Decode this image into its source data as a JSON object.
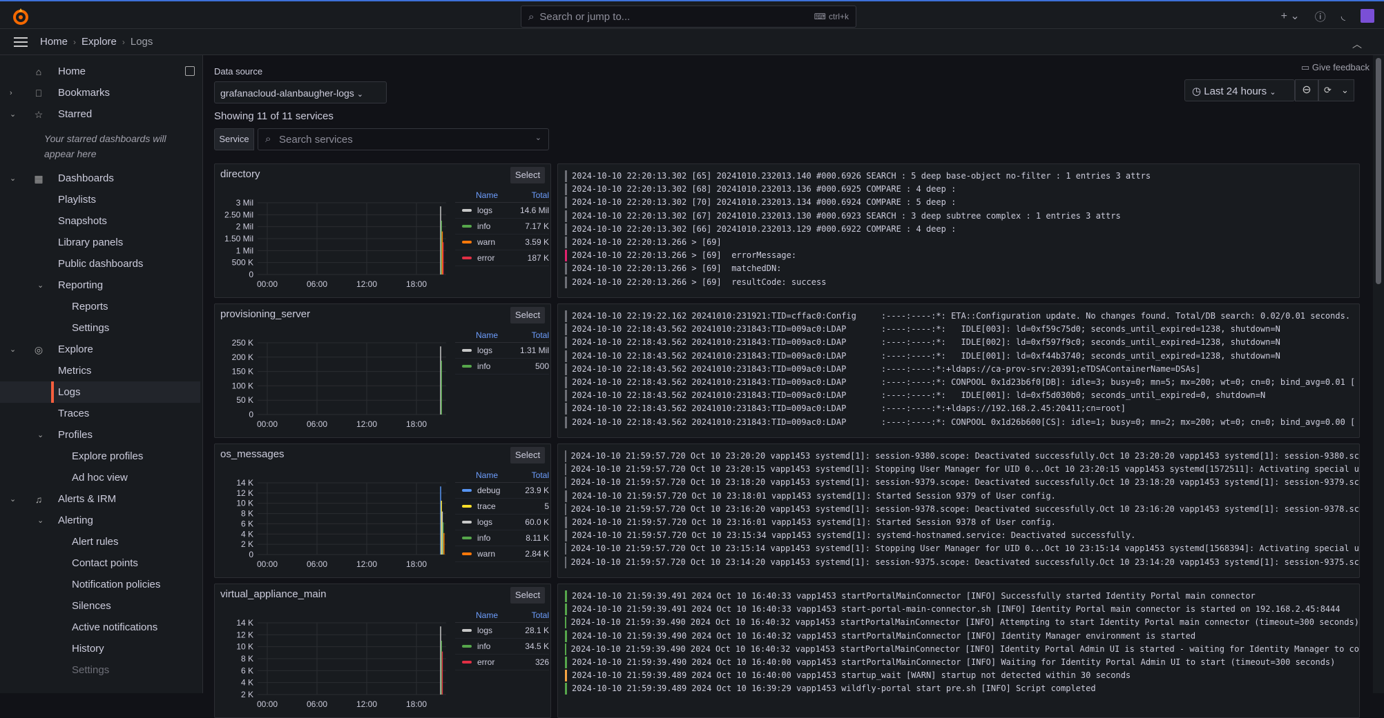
{
  "topbar": {
    "search_placeholder": "Search or jump to...",
    "search_shortcut": "ctrl+k",
    "new_label": "+"
  },
  "breadcrumb": [
    "Home",
    "Explore",
    "Logs"
  ],
  "sidebar": {
    "items": [
      {
        "label": "Home",
        "icon": "home-icon",
        "caret": ""
      },
      {
        "label": "Bookmarks",
        "icon": "bookmark-icon",
        "caret": "›"
      },
      {
        "label": "Starred",
        "icon": "star-icon",
        "caret": "⌄"
      },
      {
        "label": "Dashboards",
        "icon": "dashboards-icon",
        "caret": "⌄"
      },
      {
        "label": "Playlists"
      },
      {
        "label": "Snapshots"
      },
      {
        "label": "Library panels"
      },
      {
        "label": "Public dashboards"
      },
      {
        "label": "Reporting",
        "caret": "⌄"
      },
      {
        "label": "Reports"
      },
      {
        "label": "Settings"
      },
      {
        "label": "Explore",
        "icon": "compass-icon",
        "caret": "⌄"
      },
      {
        "label": "Metrics"
      },
      {
        "label": "Logs"
      },
      {
        "label": "Traces"
      },
      {
        "label": "Profiles",
        "caret": "⌄"
      },
      {
        "label": "Explore profiles"
      },
      {
        "label": "Ad hoc view"
      },
      {
        "label": "Alerts & IRM",
        "icon": "bell-icon",
        "caret": "⌄"
      },
      {
        "label": "Alerting",
        "caret": "⌄"
      },
      {
        "label": "Alert rules"
      },
      {
        "label": "Contact points"
      },
      {
        "label": "Notification policies"
      },
      {
        "label": "Silences"
      },
      {
        "label": "Active notifications"
      },
      {
        "label": "History"
      },
      {
        "label": "Settings"
      }
    ],
    "starred_note": "Your starred dashboards will appear here"
  },
  "toolbar": {
    "data_source_label": "Data source",
    "data_source": "grafanacloud-alanbaugher-logs",
    "showing": "Showing 11 of 11 services",
    "service_tag": "Service",
    "search_services": "Search services",
    "feedback": "Give feedback",
    "time_range": "Last 24 hours"
  },
  "panels": [
    {
      "title": "directory",
      "select": "Select",
      "y_ticks": [
        "3 Mil",
        "2.50 Mil",
        "2 Mil",
        "1.50 Mil",
        "1 Mil",
        "500 K",
        "0"
      ],
      "legend": [
        {
          "name": "logs",
          "total": "14.6 Mil",
          "color": "#c7c7c7"
        },
        {
          "name": "info",
          "total": "7.17 K",
          "color": "#56a64b"
        },
        {
          "name": "warn",
          "total": "3.59 K",
          "color": "#ff780a"
        },
        {
          "name": "error",
          "total": "187 K",
          "color": "#e02f44"
        }
      ],
      "logs": [
        {
          "l": "info_g",
          "t": "2024-10-10 22:20:13.302 [65] 20241010.232013.140 #000.6926 SEARCH : 5 deep base-object no-filter : 1 entries 3 attrs"
        },
        {
          "l": "n",
          "t": "2024-10-10 22:20:13.302 [68] 20241010.232013.136 #000.6925 COMPARE : 4 deep :"
        },
        {
          "l": "n",
          "t": "2024-10-10 22:20:13.302 [70] 20241010.232013.134 #000.6924 COMPARE : 5 deep :"
        },
        {
          "l": "n",
          "t": "2024-10-10 22:20:13.302 [67] 20241010.232013.130 #000.6923 SEARCH : 3 deep subtree complex : 1 entries 3 attrs"
        },
        {
          "l": "n",
          "t": "2024-10-10 22:20:13.302 [66] 20241010.232013.129 #000.6922 COMPARE : 4 deep :"
        },
        {
          "l": "n",
          "t": "2024-10-10 22:20:13.266 > [69]"
        },
        {
          "l": "err",
          "t": "2024-10-10 22:20:13.266 > [69]  errorMessage:"
        },
        {
          "l": "n",
          "t": "2024-10-10 22:20:13.266 > [69]  matchedDN:"
        },
        {
          "l": "n",
          "t": "2024-10-10 22:20:13.266 > [69]  resultCode: success"
        }
      ]
    },
    {
      "title": "provisioning_server",
      "select": "Select",
      "y_ticks": [
        "250 K",
        "200 K",
        "150 K",
        "100 K",
        "50 K",
        "0"
      ],
      "legend": [
        {
          "name": "logs",
          "total": "1.31 Mil",
          "color": "#c7c7c7"
        },
        {
          "name": "info",
          "total": "500",
          "color": "#56a64b"
        }
      ],
      "logs": [
        {
          "l": "n",
          "t": "2024-10-10 22:19:22.162 20241010:231921:TID=cffac0:Config     :----:----:*: ETA::Configuration update. No changes found. Total/DB search: 0.02/0.01 seconds."
        },
        {
          "l": "n",
          "t": "2024-10-10 22:18:43.562 20241010:231843:TID=009ac0:LDAP       :----:----:*:   IDLE[003]: ld=0xf59c75d0; seconds_until_expired=1238, shutdown=N"
        },
        {
          "l": "n",
          "t": "2024-10-10 22:18:43.562 20241010:231843:TID=009ac0:LDAP       :----:----:*:   IDLE[002]: ld=0xf597f9c0; seconds_until_expired=1238, shutdown=N"
        },
        {
          "l": "n",
          "t": "2024-10-10 22:18:43.562 20241010:231843:TID=009ac0:LDAP       :----:----:*:   IDLE[001]: ld=0xf44b3740; seconds_until_expired=1238, shutdown=N"
        },
        {
          "l": "n",
          "t": "2024-10-10 22:18:43.562 20241010:231843:TID=009ac0:LDAP       :----:----:*:+ldaps://ca-prov-srv:20391;eTDSAContainerName=DSAs]"
        },
        {
          "l": "n",
          "t": "2024-10-10 22:18:43.562 20241010:231843:TID=009ac0:LDAP       :----:----:*: CONPOOL 0x1d23b6f0[DB]: idle=3; busy=0; mn=5; mx=200; wt=0; cn=0; bind_avg=0.01 ["
        },
        {
          "l": "n",
          "t": "2024-10-10 22:18:43.562 20241010:231843:TID=009ac0:LDAP       :----:----:*:   IDLE[001]: ld=0xf5d030b0; seconds_until_expired=0, shutdown=N"
        },
        {
          "l": "n",
          "t": "2024-10-10 22:18:43.562 20241010:231843:TID=009ac0:LDAP       :----:----:*:+ldaps://192.168.2.45:20411;cn=root]"
        },
        {
          "l": "n",
          "t": "2024-10-10 22:18:43.562 20241010:231843:TID=009ac0:LDAP       :----:----:*: CONPOOL 0x1d26b600[CS]: idle=1; busy=0; mn=2; mx=200; wt=0; cn=0; bind_avg=0.00 ["
        }
      ]
    },
    {
      "title": "os_messages",
      "select": "Select",
      "y_ticks": [
        "14 K",
        "12 K",
        "10 K",
        "8 K",
        "6 K",
        "4 K",
        "2 K",
        "0"
      ],
      "legend": [
        {
          "name": "debug",
          "total": "23.9 K",
          "color": "#5794f2"
        },
        {
          "name": "trace",
          "total": "5",
          "color": "#fade2a"
        },
        {
          "name": "logs",
          "total": "60.0 K",
          "color": "#c7c7c7"
        },
        {
          "name": "info",
          "total": "8.11 K",
          "color": "#56a64b"
        },
        {
          "name": "warn",
          "total": "2.84 K",
          "color": "#ff780a"
        }
      ],
      "logs": [
        {
          "l": "n",
          "t": "2024-10-10 21:59:57.720 Oct 10 23:20:20 vapp1453 systemd[1]: session-9380.scope: Deactivated successfully.Oct 10 23:20:20 vapp1453 systemd[1]: session-9380.sc"
        },
        {
          "l": "n",
          "t": "2024-10-10 21:59:57.720 Oct 10 23:20:15 vapp1453 systemd[1]: Stopping User Manager for UID 0...Oct 10 23:20:15 vapp1453 systemd[1572511]: Activating special u"
        },
        {
          "l": "n",
          "t": "2024-10-10 21:59:57.720 Oct 10 23:18:20 vapp1453 systemd[1]: session-9379.scope: Deactivated successfully.Oct 10 23:18:20 vapp1453 systemd[1]: session-9379.sc"
        },
        {
          "l": "n",
          "t": "2024-10-10 21:59:57.720 Oct 10 23:18:01 vapp1453 systemd[1]: Started Session 9379 of User config."
        },
        {
          "l": "n",
          "t": "2024-10-10 21:59:57.720 Oct 10 23:16:20 vapp1453 systemd[1]: session-9378.scope: Deactivated successfully.Oct 10 23:16:20 vapp1453 systemd[1]: session-9378.sc"
        },
        {
          "l": "n",
          "t": "2024-10-10 21:59:57.720 Oct 10 23:16:01 vapp1453 systemd[1]: Started Session 9378 of User config."
        },
        {
          "l": "n",
          "t": "2024-10-10 21:59:57.720 Oct 10 23:15:34 vapp1453 systemd[1]: systemd-hostnamed.service: Deactivated successfully."
        },
        {
          "l": "n",
          "t": "2024-10-10 21:59:57.720 Oct 10 23:15:14 vapp1453 systemd[1]: Stopping User Manager for UID 0...Oct 10 23:15:14 vapp1453 systemd[1568394]: Activating special u"
        },
        {
          "l": "n",
          "t": "2024-10-10 21:59:57.720 Oct 10 23:14:20 vapp1453 systemd[1]: session-9375.scope: Deactivated successfully.Oct 10 23:14:20 vapp1453 systemd[1]: session-9375.sc"
        }
      ]
    },
    {
      "title": "virtual_appliance_main",
      "select": "Select",
      "y_ticks": [
        "14 K",
        "12 K",
        "10 K",
        "8 K",
        "6 K",
        "4 K",
        "2 K"
      ],
      "legend": [
        {
          "name": "logs",
          "total": "28.1 K",
          "color": "#c7c7c7"
        },
        {
          "name": "info",
          "total": "34.5 K",
          "color": "#56a64b"
        },
        {
          "name": "error",
          "total": "326",
          "color": "#e02f44"
        }
      ],
      "logs": [
        {
          "l": "info",
          "t": "2024-10-10 21:59:39.491 2024 Oct 10 16:40:33 vapp1453 startPortalMainConnector [INFO] Successfully started Identity Portal main connector"
        },
        {
          "l": "info",
          "t": "2024-10-10 21:59:39.491 2024 Oct 10 16:40:33 vapp1453 start-portal-main-connector.sh [INFO] Identity Portal main connector is started on 192.168.2.45:8444"
        },
        {
          "l": "info",
          "t": "2024-10-10 21:59:39.490 2024 Oct 10 16:40:32 vapp1453 startPortalMainConnector [INFO] Attempting to start Identity Portal main connector (timeout=300 seconds)"
        },
        {
          "l": "info",
          "t": "2024-10-10 21:59:39.490 2024 Oct 10 16:40:32 vapp1453 startPortalMainConnector [INFO] Identity Manager environment is started"
        },
        {
          "l": "info",
          "t": "2024-10-10 21:59:39.490 2024 Oct 10 16:40:32 vapp1453 startPortalMainConnector [INFO] Identity Portal Admin UI is started - waiting for Identity Manager to co"
        },
        {
          "l": "info",
          "t": "2024-10-10 21:59:39.490 2024 Oct 10 16:40:00 vapp1453 startPortalMainConnector [INFO] Waiting for Identity Portal Admin UI to start (timeout=300 seconds)"
        },
        {
          "l": "warn",
          "t": "2024-10-10 21:59:39.489 2024 Oct 10 16:40:00 vapp1453 startup_wait [WARN] startup not detected within 30 seconds"
        },
        {
          "l": "info",
          "t": "2024-10-10 21:59:39.489 2024 Oct 10 16:39:29 vapp1453 wildfly-portal start pre.sh [INFO] Script completed"
        }
      ]
    }
  ],
  "x_ticks": [
    "00:00",
    "06:00",
    "12:00",
    "18:00"
  ],
  "legend_headers": {
    "name": "Name",
    "total": "Total"
  },
  "colors": {
    "accent": "#3d71d9",
    "active": "#f55f3e"
  }
}
